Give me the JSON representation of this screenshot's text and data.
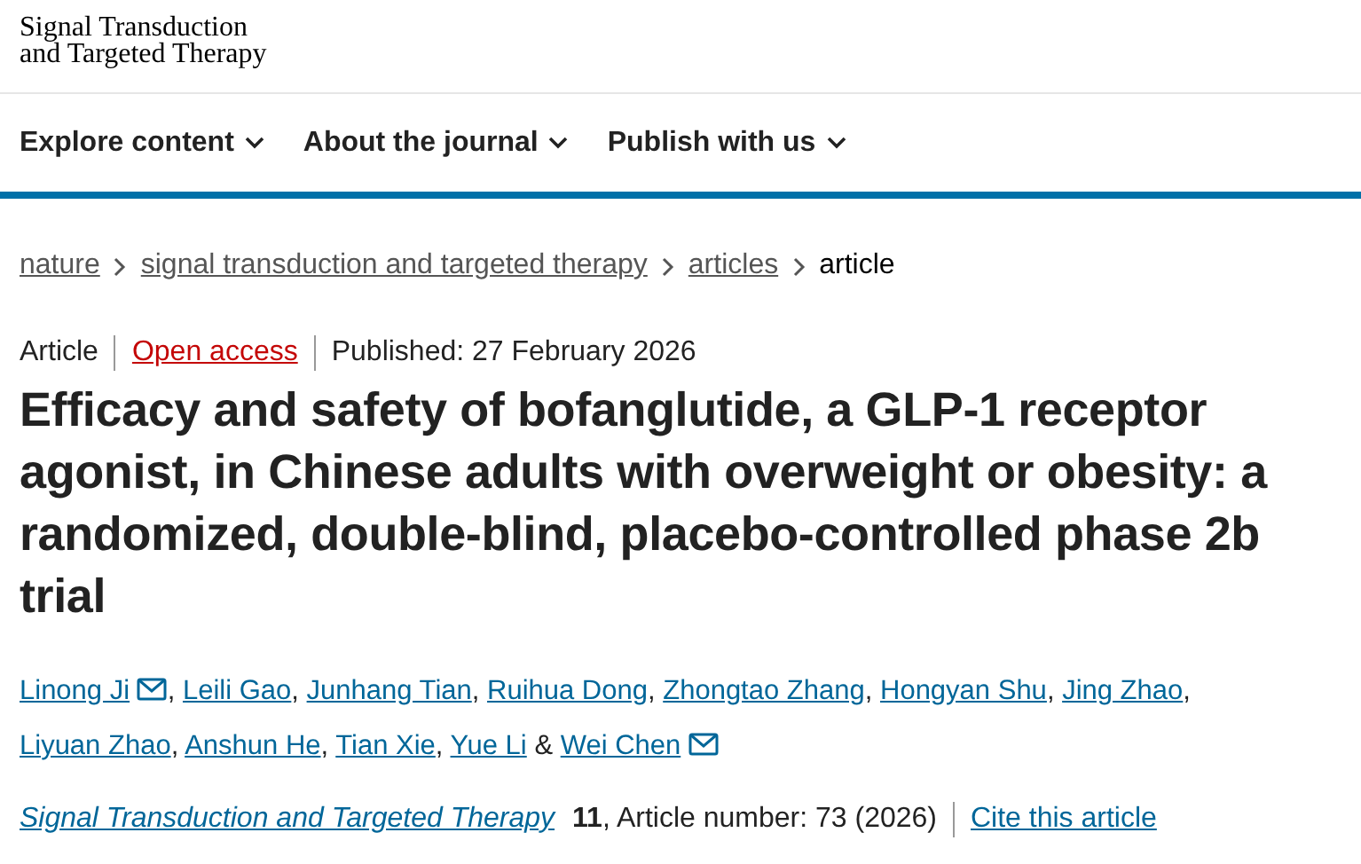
{
  "logo": [
    "Signal Transduction",
    "and Targeted Therapy"
  ],
  "nav": [
    {
      "label": "Explore content"
    },
    {
      "label": "About the journal"
    },
    {
      "label": "Publish with us"
    }
  ],
  "breadcrumbs": [
    {
      "label": "nature",
      "current": false
    },
    {
      "label": "signal transduction and targeted therapy",
      "current": false
    },
    {
      "label": "articles",
      "current": false
    },
    {
      "label": "article",
      "current": true
    }
  ],
  "meta": {
    "type": "Article",
    "access": "Open access",
    "published": "Published: 27 February 2026"
  },
  "title": "Efficacy and safety of bofanglutide, a GLP-1 receptor agonist, in Chinese adults with overweight or obesity: a randomized, double-blind, placebo-controlled phase 2b trial",
  "authors": [
    {
      "name": "Linong Ji",
      "corresponding": true,
      "after": ","
    },
    {
      "name": "Leili Gao",
      "corresponding": false,
      "after": ","
    },
    {
      "name": "Junhang Tian",
      "corresponding": false,
      "after": ","
    },
    {
      "name": "Ruihua Dong",
      "corresponding": false,
      "after": ","
    },
    {
      "name": "Zhongtao Zhang",
      "corresponding": false,
      "after": ","
    },
    {
      "name": "Hongyan Shu",
      "corresponding": false,
      "after": ","
    },
    {
      "name": "Jing Zhao",
      "corresponding": false,
      "after": ","
    },
    {
      "name": "Liyuan Zhao",
      "corresponding": false,
      "after": ","
    },
    {
      "name": "Anshun He",
      "corresponding": false,
      "after": ","
    },
    {
      "name": "Tian Xie",
      "corresponding": false,
      "after": ","
    },
    {
      "name": "Yue Li",
      "corresponding": false,
      "after": "&"
    },
    {
      "name": "Wei Chen",
      "corresponding": true
    }
  ],
  "citation": {
    "journal": "Signal Transduction and Targeted Therapy",
    "volume": "11",
    "details": ", Article number: 73 (2026)",
    "cite": "Cite this article"
  }
}
